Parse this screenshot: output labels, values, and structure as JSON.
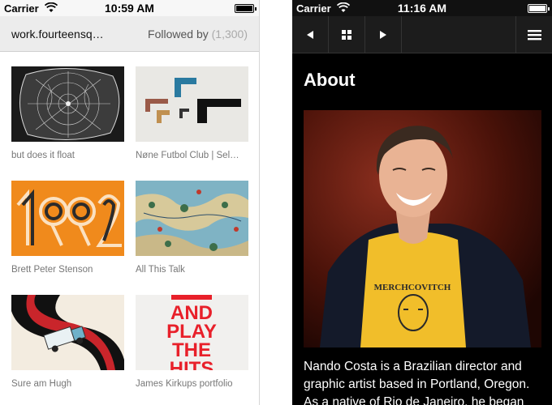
{
  "left_screen": {
    "status": {
      "carrier": "Carrier",
      "time": "10:59 AM"
    },
    "nav": {
      "title": "work.fourteensq…",
      "followed_label": "Followed by",
      "followed_count": "(1,300)"
    },
    "items": [
      {
        "caption": "but does it float",
        "icon": "lace-artwork"
      },
      {
        "caption": "Nøne Futbol Club | Sel…",
        "icon": "wall-objects"
      },
      {
        "caption": "Brett Peter Stenson",
        "icon": "1992-typography"
      },
      {
        "caption": "All This Talk",
        "icon": "illustrated-map"
      },
      {
        "caption": "Sure am Hugh",
        "icon": "truck-illustration"
      },
      {
        "caption": "James Kirkups portfolio",
        "icon": "poster-play-the-hits"
      }
    ],
    "poster_text": [
      "AND",
      "PLAY",
      "THE",
      "HITS"
    ]
  },
  "right_screen": {
    "status": {
      "carrier": "Carrier",
      "time": "11:16 AM"
    },
    "toolbar": {
      "back_icon": "triangle-left-icon",
      "grid_icon": "grid-icon",
      "forward_icon": "triangle-right-icon",
      "menu_icon": "hamburger-icon"
    },
    "heading": "About",
    "portrait_shirt_text": "MERCHCOVITCH",
    "bio": "Nando Costa is a Brazilian director and graphic artist based in Portland, Oregon. As a native of Rio de Janeiro, he began"
  },
  "colors": {
    "left_background": "#ffffff",
    "right_background": "#000000",
    "caption_text": "#777777",
    "accent_orange": "#f08a1c",
    "poster_red": "#e8202a"
  }
}
